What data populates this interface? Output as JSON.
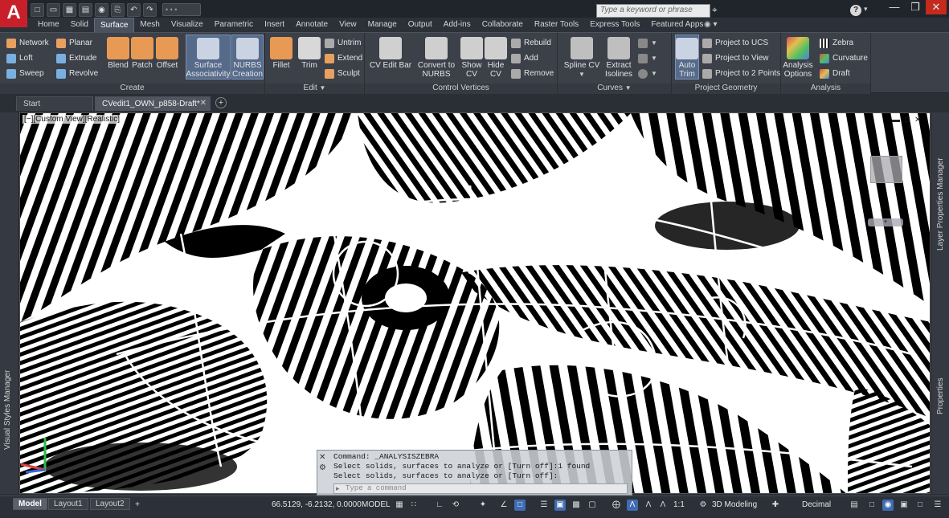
{
  "app": {
    "logo": "A",
    "workspace_label": "• • •"
  },
  "search": {
    "placeholder": "Type a keyword or phrase"
  },
  "window_controls": {
    "minimize": "—",
    "restore": "❒",
    "close": "✕"
  },
  "ribbon_tabs": [
    "Home",
    "Solid",
    "Surface",
    "Mesh",
    "Visualize",
    "Parametric",
    "Insert",
    "Annotate",
    "View",
    "Manage",
    "Output",
    "Add-ins",
    "Collaborate",
    "Raster Tools",
    "Express Tools",
    "Featured Apps"
  ],
  "ribbon_active_tab": "Surface",
  "ribbon": {
    "create": {
      "title": "Create",
      "network": "Network",
      "planar": "Planar",
      "loft": "Loft",
      "extrude": "Extrude",
      "sweep": "Sweep",
      "revolve": "Revolve",
      "blend": "Blend",
      "patch": "Patch",
      "offset": "Offset",
      "surface_assoc": "Surface Associativity",
      "nurbs_creation": "NURBS Creation"
    },
    "edit": {
      "title": "Edit",
      "fillet": "Fillet",
      "trim": "Trim",
      "untrim": "Untrim",
      "extend": "Extend",
      "sculpt": "Sculpt"
    },
    "control_vertices": {
      "title": "Control Vertices",
      "cv_edit_bar": "CV Edit Bar",
      "convert_nurbs": "Convert to NURBS",
      "show_cv": "Show CV",
      "hide_cv": "Hide CV",
      "rebuild": "Rebuild",
      "add": "Add",
      "remove": "Remove"
    },
    "curves": {
      "title": "Curves",
      "spline_cv": "Spline CV",
      "extract_isolines": "Extract Isolines"
    },
    "project_geometry": {
      "title": "Project Geometry",
      "auto_trim": "Auto Trim",
      "project_ucs": "Project to UCS",
      "project_view": "Project to View",
      "project_2pts": "Project to 2 Points"
    },
    "analysis": {
      "title": "Analysis",
      "analysis_options": "Analysis Options",
      "zebra": "Zebra",
      "curvature": "Curvature",
      "draft": "Draft"
    }
  },
  "doc_tabs": [
    {
      "label": "Start"
    },
    {
      "label": "CVedit1_OWN_p858-Draft*"
    }
  ],
  "viewport": {
    "label": "[−][Custom View][Realistic]"
  },
  "left_palette": "Visual Styles Manager",
  "right_palettes": [
    "Layer Properties Manager",
    "Properties"
  ],
  "command_line": {
    "lines": [
      "Command: _ANALYSISZEBRA",
      "Select solids, surfaces to analyze or [Turn off]:1 found",
      "Select solids, surfaces to analyze or [Turn off]:"
    ],
    "input_placeholder": "Type a command"
  },
  "layout_tabs": [
    "Model",
    "Layout1",
    "Layout2"
  ],
  "status": {
    "coords": "66.5129, -6.2132, 0.0000",
    "space": "MODEL",
    "scale": "1:1",
    "workspace": "3D Modeling",
    "units": "Decimal"
  },
  "colors": {
    "accent": "#3f6cb2",
    "logo_red": "#c8202a"
  }
}
